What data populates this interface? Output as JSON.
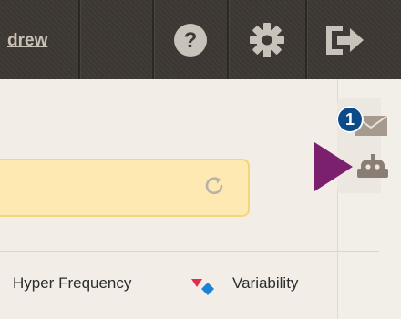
{
  "header": {
    "user_link": "drew",
    "help_icon": "question-circle-icon",
    "settings_icon": "gear-icon",
    "logout_icon": "sign-out-icon"
  },
  "main": {
    "search_refresh_icon": "refresh-icon",
    "legend": [
      {
        "label": "Hyper Frequency"
      },
      {
        "label": "Variability",
        "icon": "variability-icon"
      }
    ]
  },
  "dock": {
    "mail_icon": "mail-icon",
    "mail_badge": "1",
    "robot_icon": "robot-icon"
  },
  "colors": {
    "topbar": "#3d3833",
    "search_fill": "#fde9b1",
    "search_border": "#f7d477",
    "badge": "#0c4a88",
    "pointer": "#7b1f6f"
  }
}
